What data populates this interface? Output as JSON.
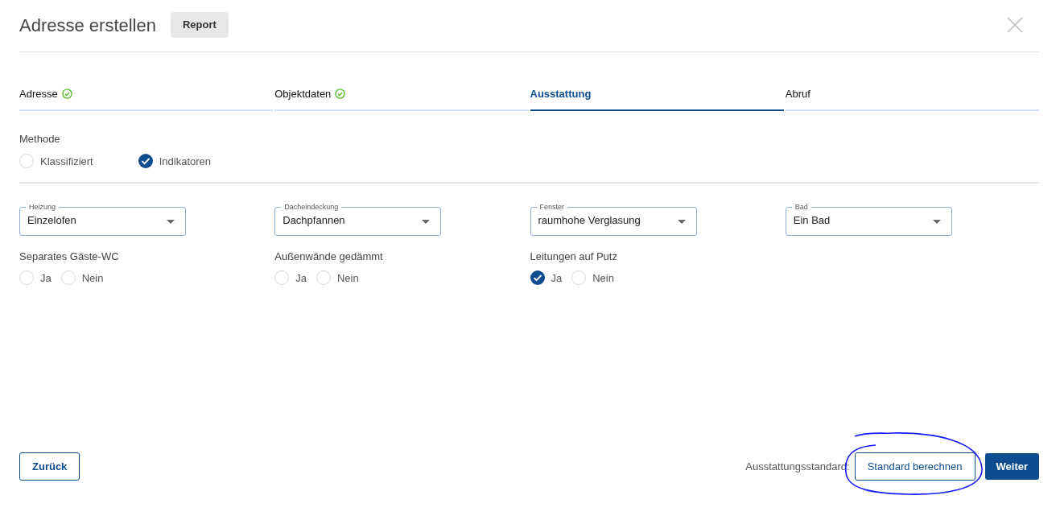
{
  "title": "Adresse erstellen",
  "report_button": "Report",
  "tabs": [
    {
      "label": "Adresse",
      "done": true,
      "selected": false
    },
    {
      "label": "Objektdaten",
      "done": true,
      "selected": false
    },
    {
      "label": "Ausstattung",
      "done": false,
      "selected": true
    },
    {
      "label": "Abruf",
      "done": false,
      "selected": false
    }
  ],
  "method": {
    "label": "Methode",
    "options": [
      {
        "label": "Klassifiziert",
        "selected": false
      },
      {
        "label": "Indikatoren",
        "selected": true
      }
    ]
  },
  "selects": [
    {
      "label": "Heizung",
      "value": "Einzelofen"
    },
    {
      "label": "Dacheindeckung",
      "value": "Dachpfannen"
    },
    {
      "label": "Fenster",
      "value": "raumhohe Verglasung"
    },
    {
      "label": "Bad",
      "value": "Ein Bad"
    }
  ],
  "questions": [
    {
      "label": "Separates Gäste-WC",
      "options": [
        {
          "label": "Ja",
          "selected": false
        },
        {
          "label": "Nein",
          "selected": false
        }
      ]
    },
    {
      "label": "Außenwände gedämmt",
      "options": [
        {
          "label": "Ja",
          "selected": false
        },
        {
          "label": "Nein",
          "selected": false
        }
      ]
    },
    {
      "label": "Leitungen auf Putz",
      "options": [
        {
          "label": "Ja",
          "selected": true
        },
        {
          "label": "Nein",
          "selected": false
        }
      ]
    }
  ],
  "footer": {
    "back_button": "Zurück",
    "standard_label": "Ausstattungsstandard:",
    "calculate_button": "Standard berechnen",
    "next_button": "Weiter"
  }
}
